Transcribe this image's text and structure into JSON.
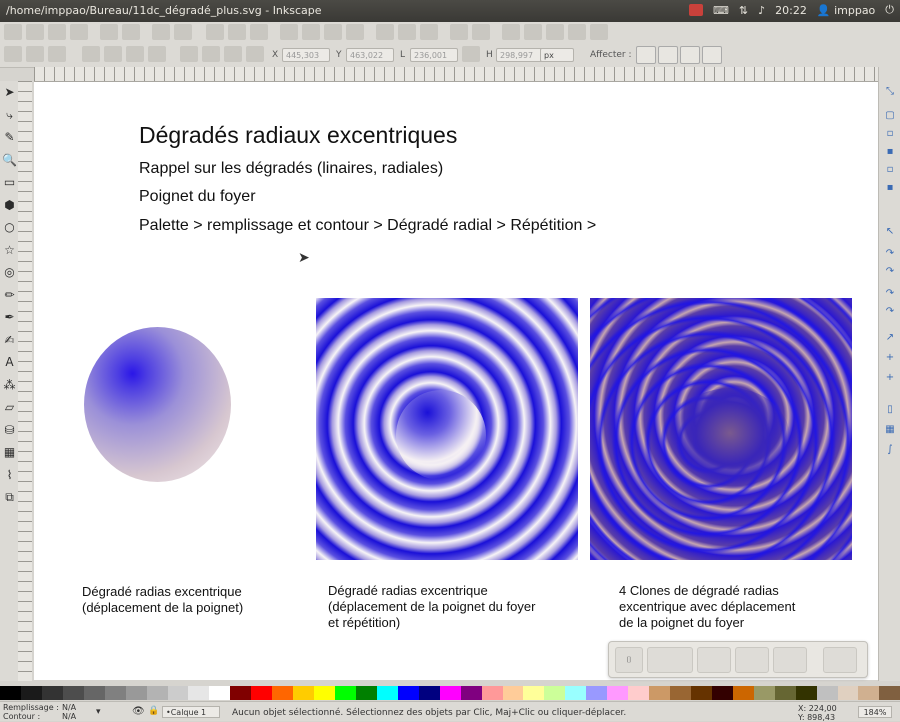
{
  "window": {
    "title": "/home/imppao/Bureau/11dc_dégradé_plus.svg - Inkscape",
    "clock": "20:22",
    "user": "imppao"
  },
  "toolbar": {
    "x_value": "445,303",
    "y_value": "463,022",
    "w_value": "236,001",
    "h_value": "298,997",
    "unit": "px",
    "affect_label": "Affecter :",
    "x_label": "X",
    "y_label": "Y",
    "w_label": "L",
    "h_label": "H"
  },
  "toolbox": [
    {
      "icon": "select-icon",
      "glyph": "➤"
    },
    {
      "icon": "node-icon",
      "glyph": "⤷"
    },
    {
      "icon": "tweak-icon",
      "glyph": "✎"
    },
    {
      "icon": "zoom-icon",
      "glyph": "🔍"
    },
    {
      "icon": "rect-icon",
      "glyph": "▭"
    },
    {
      "icon": "3dbox-icon",
      "glyph": "⬢"
    },
    {
      "icon": "ellipse-icon",
      "glyph": "○"
    },
    {
      "icon": "star-icon",
      "glyph": "☆"
    },
    {
      "icon": "spiral-icon",
      "glyph": "◎"
    },
    {
      "icon": "pencil-icon",
      "glyph": "✏"
    },
    {
      "icon": "pen-icon",
      "glyph": "✒"
    },
    {
      "icon": "calligraphy-icon",
      "glyph": "✍"
    },
    {
      "icon": "text-icon",
      "glyph": "A"
    },
    {
      "icon": "spray-icon",
      "glyph": "⁂"
    },
    {
      "icon": "eraser-icon",
      "glyph": "▱"
    },
    {
      "icon": "bucket-icon",
      "glyph": "⛁"
    },
    {
      "icon": "gradient-icon",
      "glyph": "▦"
    },
    {
      "icon": "dropper-icon",
      "glyph": "⌇"
    },
    {
      "icon": "connector-icon",
      "glyph": "⧉"
    }
  ],
  "canvas": {
    "heading": "Dégradés radiaux excentriques",
    "lines": [
      "Rappel sur les dégradés (linaires, radiales)",
      "Poignet du foyer",
      "Palette > remplissage et contour > Dégradé radial > Répétition >"
    ],
    "captions": [
      [
        "Dégradé radias excentrique",
        "(déplacement de la poignet)"
      ],
      [
        "Dégradé radias excentrique",
        "(déplacement de la poignet du foyer",
        "et répétition)"
      ],
      [
        "4 Clones de dégradé radias",
        "excentrique avec déplacement",
        "de la poignet du foyer"
      ]
    ]
  },
  "status": {
    "fill_label": "Remplissage :",
    "fill_value": "N/A",
    "stroke_label": "Contour :",
    "stroke_value": "N/A",
    "layer": "•Calque 1",
    "message": "Aucun objet sélectionné. Sélectionnez des objets par Clic, Maj+Clic ou cliquer-déplacer.",
    "x_coord": "X: 224,00",
    "y_coord": "Y: 898,43",
    "zoom": "184%"
  },
  "palette": [
    "#000000",
    "#1a1a1a",
    "#333333",
    "#4d4d4d",
    "#666666",
    "#808080",
    "#999999",
    "#b3b3b3",
    "#cccccc",
    "#e6e6e6",
    "#ffffff",
    "#800000",
    "#ff0000",
    "#ff6600",
    "#ffcc00",
    "#ffff00",
    "#00ff00",
    "#008000",
    "#00ffff",
    "#0000ff",
    "#000080",
    "#ff00ff",
    "#800080",
    "#ff9999",
    "#ffcc99",
    "#ffff99",
    "#ccff99",
    "#99ffff",
    "#9999ff",
    "#ff99ff",
    "#ffcccc",
    "#cc9966",
    "#996633",
    "#663300",
    "#330000",
    "#cc6600",
    "#999966",
    "#666633",
    "#333300",
    "#c0c0c0",
    "#e0d0c0",
    "#d0b090",
    "#806040"
  ]
}
